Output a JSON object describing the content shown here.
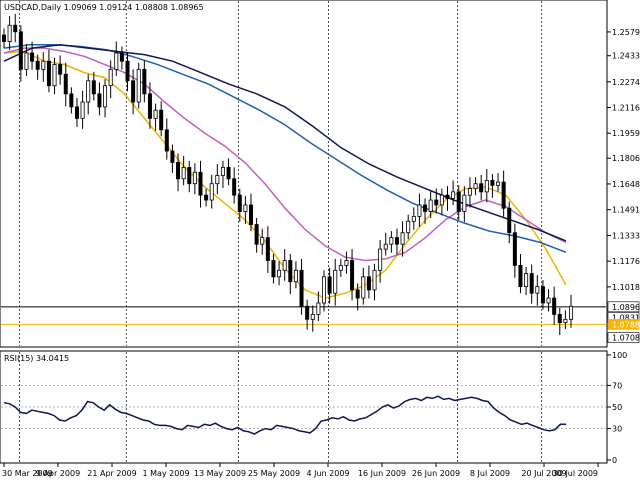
{
  "header": {
    "symbol_line": "USDCAD,Daily  1.09069 1.09124 1.08808 1.08965",
    "rsi_line": "RSI(15) 34.0415"
  },
  "chart_data": [
    {
      "type": "candlestick",
      "symbol": "USDCAD",
      "timeframe": "Daily",
      "ohlc_header": {
        "open": 1.09069,
        "high": 1.09124,
        "low": 1.08808,
        "close": 1.08965
      },
      "ylim": [
        1.0675,
        1.275
      ],
      "y_ticks": [
        "1.25790",
        "1.24335",
        "1.22740",
        "1.21165",
        "1.19590",
        "1.18060",
        "1.16485",
        "1.14910",
        "1.13335",
        "1.11760",
        "1.10185"
      ],
      "price_labels": [
        {
          "text": "1.08965",
          "value": 1.08965,
          "color": "#000000",
          "bg": "#ffffff"
        },
        {
          "text": "1.08310",
          "value": 1.0831,
          "color": "#000000",
          "bg": "#ffffff"
        },
        {
          "text": "1.07887",
          "value": 1.07887,
          "color": "#ffffff",
          "bg": "#f5b400"
        },
        {
          "text": "1.07080",
          "value": 1.0708,
          "color": "#000000",
          "bg": "#ffffff"
        }
      ],
      "horizontal_lines": [
        {
          "value": 1.08965,
          "color": "#000000"
        },
        {
          "value": 1.07887,
          "color": "#f0b400"
        }
      ],
      "x_labels": [
        "30 Mar 2009",
        "9 Apr 2009",
        "21 Apr 2009",
        "1 May 2009",
        "13 May 2009",
        "25 May 2009",
        "4 Jun 2009",
        "16 Jun 2009",
        "26 Jun 2009",
        "8 Jul 2009",
        "20 Jul 2009",
        "30 Jul 2009"
      ],
      "grid": "vertical dotted period separators",
      "closes": [
        1.252,
        1.262,
        1.258,
        1.235,
        1.245,
        1.24,
        1.235,
        1.24,
        1.225,
        1.238,
        1.232,
        1.22,
        1.212,
        1.205,
        1.215,
        1.228,
        1.22,
        1.212,
        1.225,
        1.235,
        1.245,
        1.24,
        1.228,
        1.215,
        1.235,
        1.22,
        1.205,
        1.21,
        1.198,
        1.185,
        1.178,
        1.168,
        1.175,
        1.165,
        1.172,
        1.158,
        1.155,
        1.165,
        1.17,
        1.175,
        1.168,
        1.158,
        1.148,
        1.152,
        1.14,
        1.128,
        1.132,
        1.118,
        1.108,
        1.112,
        1.118,
        1.105,
        1.112,
        1.09,
        1.082,
        1.085,
        1.092,
        1.108,
        1.098,
        1.112,
        1.115,
        1.118,
        1.1,
        1.095,
        1.108,
        1.1,
        1.112,
        1.125,
        1.128,
        1.132,
        1.128,
        1.135,
        1.142,
        1.145,
        1.152,
        1.148,
        1.155,
        1.152,
        1.158,
        1.156,
        1.16,
        1.148,
        1.158,
        1.162,
        1.165,
        1.16,
        1.167,
        1.164,
        1.166,
        1.15,
        1.135,
        1.115,
        1.102,
        1.11,
        1.098,
        1.102,
        1.092,
        1.095,
        1.085,
        1.08,
        1.082,
        1.09
      ],
      "ma_series": [
        {
          "color": "#f0b400",
          "values": [
            1.245,
            1.246,
            1.24,
            1.238,
            1.233,
            1.23,
            1.22,
            1.205,
            1.19,
            1.175,
            1.163,
            1.153,
            1.143,
            1.13,
            1.113,
            1.1,
            1.095,
            1.098,
            1.103,
            1.112,
            1.128,
            1.143,
            1.155,
            1.162,
            1.163,
            1.158,
            1.143,
            1.125,
            1.103
          ]
        },
        {
          "color": "#c060c0",
          "values": [
            1.245,
            1.248,
            1.248,
            1.246,
            1.243,
            1.238,
            1.233,
            1.226,
            1.215,
            1.205,
            1.196,
            1.188,
            1.178,
            1.165,
            1.15,
            1.137,
            1.127,
            1.12,
            1.118,
            1.119,
            1.123,
            1.132,
            1.143,
            1.151,
            1.155,
            1.151,
            1.143,
            1.135,
            1.129
          ]
        },
        {
          "color": "#2060b0",
          "values": [
            1.248,
            1.25,
            1.25,
            1.249,
            1.247,
            1.243,
            1.238,
            1.232,
            1.226,
            1.218,
            1.21,
            1.201,
            1.19,
            1.18,
            1.17,
            1.161,
            1.153,
            1.147,
            1.141,
            1.136,
            1.133,
            1.129,
            1.123
          ]
        },
        {
          "color": "#101850",
          "values": [
            1.24,
            1.248,
            1.25,
            1.248,
            1.246,
            1.244,
            1.24,
            1.233,
            1.226,
            1.22,
            1.212,
            1.2,
            1.187,
            1.177,
            1.169,
            1.162,
            1.155,
            1.149,
            1.143,
            1.137,
            1.13
          ]
        }
      ]
    },
    {
      "type": "line",
      "indicator": "RSI(15)",
      "value": 34.0415,
      "ylim": [
        0,
        100
      ],
      "y_ticks": [
        "100",
        "70",
        "50",
        "30",
        "0"
      ],
      "levels": [
        70,
        50,
        30
      ],
      "color": "#101850",
      "values": [
        54,
        53,
        50,
        45,
        44,
        47,
        46,
        45,
        44,
        42,
        38,
        37,
        40,
        42,
        47,
        55,
        54,
        50,
        47,
        52,
        48,
        45,
        44,
        42,
        40,
        38,
        37,
        34,
        33,
        33,
        32,
        30,
        29,
        33,
        32,
        31,
        34,
        33,
        35,
        32,
        30,
        29,
        31,
        28,
        27,
        25,
        28,
        30,
        29,
        33,
        32,
        31,
        30,
        28,
        27,
        26,
        30,
        37,
        38,
        40,
        39,
        41,
        38,
        37,
        39,
        40,
        43,
        46,
        50,
        52,
        49,
        51,
        55,
        57,
        58,
        56,
        59,
        58,
        60,
        57,
        58,
        56,
        57,
        58,
        59,
        58,
        56,
        55,
        49,
        45,
        42,
        38,
        36,
        34,
        35,
        33,
        31,
        29,
        28,
        29,
        34,
        34
      ]
    }
  ]
}
